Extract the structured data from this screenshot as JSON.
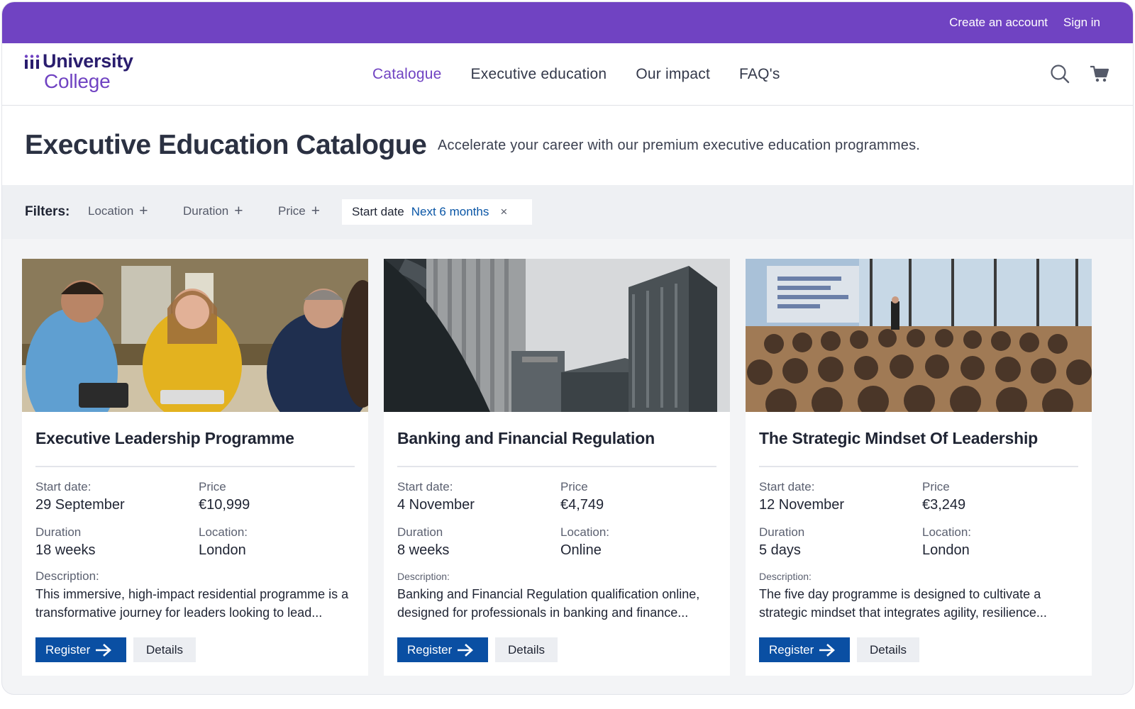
{
  "topbar": {
    "create_account": "Create an account",
    "sign_in": "Sign in"
  },
  "logo": {
    "line1": "University",
    "line2": "College"
  },
  "nav": {
    "items": [
      {
        "label": "Catalogue",
        "active": true
      },
      {
        "label": "Executive education",
        "active": false
      },
      {
        "label": "Our impact",
        "active": false
      },
      {
        "label": "FAQ's",
        "active": false
      }
    ]
  },
  "header_icons": [
    "search-icon",
    "cart-icon"
  ],
  "hero": {
    "title": "Executive Education Catalogue",
    "subtitle": "Accelerate your career with our premium executive education programmes."
  },
  "filters": {
    "label": "Filters:",
    "options": [
      {
        "label": "Location",
        "icon": "+"
      },
      {
        "label": "Duration",
        "icon": "+"
      },
      {
        "label": "Price",
        "icon": "+"
      }
    ],
    "active": {
      "key": "Start date",
      "value": "Next 6 months",
      "remove": "×"
    }
  },
  "labels": {
    "start_date": "Start date:",
    "price": "Price",
    "duration": "Duration",
    "location": "Location:",
    "description": "Description:",
    "register": "Register",
    "details": "Details"
  },
  "cards": [
    {
      "title": "Executive Leadership Programme",
      "start_date": "29 September",
      "price": "€10,999",
      "duration": "18 weeks",
      "location": "London",
      "description": "This immersive, high-impact residential programme is a transformative journey for leaders looking to lead...",
      "image": "meeting-photo"
    },
    {
      "title": "Banking and Financial Regulation",
      "start_date": "4 November",
      "price": "€4,749",
      "duration": "8 weeks",
      "location": "Online",
      "description": "Banking and Financial Regulation qualification online, designed for professionals in banking and finance...",
      "image": "skyscrapers-photo"
    },
    {
      "title": "The Strategic Mindset Of Leadership",
      "start_date": "12 November",
      "price": "€3,249",
      "duration": "5 days",
      "location": "London",
      "description": "The five day programme is designed to cultivate a strategic mindset that integrates agility, resilience...",
      "image": "conference-photo"
    }
  ],
  "colors": {
    "brand": "#7043c2",
    "primary_button": "#0a4fa3",
    "filter_value": "#0a56a6"
  }
}
